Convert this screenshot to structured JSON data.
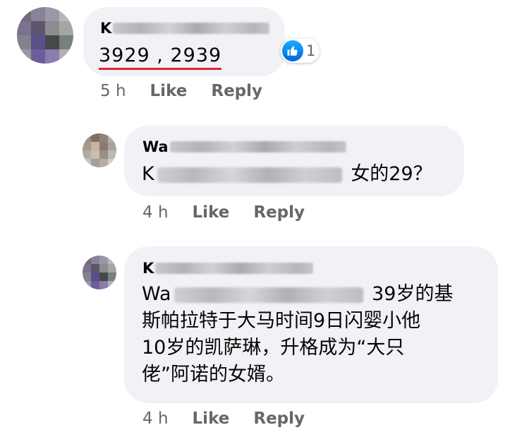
{
  "comments": [
    {
      "name_prefix": "K",
      "text": "3929 , 2939",
      "reaction_count": "1",
      "time": "5 h",
      "like_label": "Like",
      "reply_label": "Reply"
    }
  ],
  "replies": [
    {
      "name_prefix": "Wa",
      "mention_prefix": "K",
      "text_after": "女的29？",
      "time": "4 h",
      "like_label": "Like",
      "reply_label": "Reply"
    },
    {
      "name_prefix": "K",
      "mention_prefix": "Wa",
      "text_line1": "39岁的基",
      "text_line2": "斯帕拉特于大马时间9日闪婴小他",
      "text_line3": "10岁的凯萨琳，升格成为“大只",
      "text_line4": "佬”阿诺的女婿。",
      "time": "4 h",
      "like_label": "Like",
      "reply_label": "Reply"
    }
  ],
  "colors": {
    "bubble": "#f0f2f5",
    "meta": "#65676b",
    "underline": "#e4203a",
    "like_blue": "#1877f2"
  }
}
